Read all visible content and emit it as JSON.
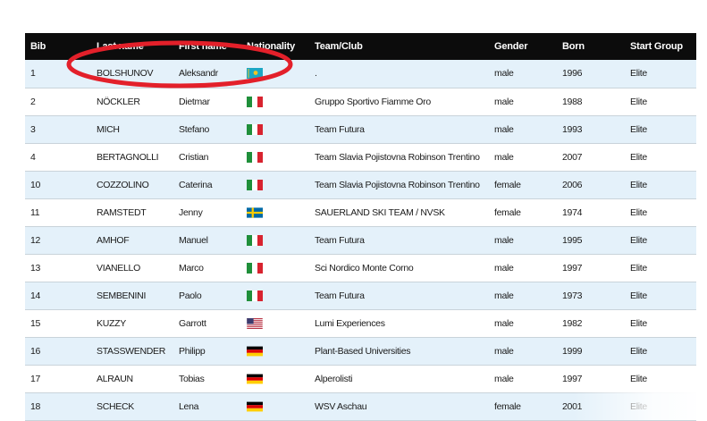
{
  "table": {
    "headers": [
      "Bib",
      "Last name",
      "First name",
      "Nationality",
      "Team/Club",
      "Gender",
      "Born",
      "Start Group"
    ],
    "rows": [
      {
        "bib": "1",
        "last": "BOLSHUNOV",
        "first": "Aleksandr",
        "flag": "kazakhstan-flag-icon",
        "team": ".",
        "gender": "male",
        "born": "1996",
        "group": "Elite"
      },
      {
        "bib": "2",
        "last": "NÖCKLER",
        "first": "Dietmar",
        "flag": "italy-flag-icon",
        "team": "Gruppo Sportivo Fiamme Oro",
        "gender": "male",
        "born": "1988",
        "group": "Elite"
      },
      {
        "bib": "3",
        "last": "MICH",
        "first": "Stefano",
        "flag": "italy-flag-icon",
        "team": "Team Futura",
        "gender": "male",
        "born": "1993",
        "group": "Elite"
      },
      {
        "bib": "4",
        "last": "BERTAGNOLLI",
        "first": "Cristian",
        "flag": "italy-flag-icon",
        "team": "Team Slavia Pojistovna Robinson Trentino",
        "gender": "male",
        "born": "2007",
        "group": "Elite"
      },
      {
        "bib": "10",
        "last": "COZZOLINO",
        "first": "Caterina",
        "flag": "italy-flag-icon",
        "team": "Team Slavia Pojistovna Robinson Trentino",
        "gender": "female",
        "born": "2006",
        "group": "Elite"
      },
      {
        "bib": "11",
        "last": "RAMSTEDT",
        "first": "Jenny",
        "flag": "sweden-flag-icon",
        "team": "SAUERLAND SKI TEAM / NVSK",
        "gender": "female",
        "born": "1974",
        "group": "Elite"
      },
      {
        "bib": "12",
        "last": "AMHOF",
        "first": "Manuel",
        "flag": "italy-flag-icon",
        "team": "Team Futura",
        "gender": "male",
        "born": "1995",
        "group": "Elite"
      },
      {
        "bib": "13",
        "last": "VIANELLO",
        "first": "Marco",
        "flag": "italy-flag-icon",
        "team": "Sci Nordico Monte Corno",
        "gender": "male",
        "born": "1997",
        "group": "Elite"
      },
      {
        "bib": "14",
        "last": "SEMBENINI",
        "first": "Paolo",
        "flag": "italy-flag-icon",
        "team": "Team Futura",
        "gender": "male",
        "born": "1973",
        "group": "Elite"
      },
      {
        "bib": "15",
        "last": "KUZZY",
        "first": "Garrott",
        "flag": "usa-flag-icon",
        "team": "Lumi Experiences",
        "gender": "male",
        "born": "1982",
        "group": "Elite"
      },
      {
        "bib": "16",
        "last": "STASSWENDER",
        "first": "Philipp",
        "flag": "germany-flag-icon",
        "team": "Plant-Based Universities",
        "gender": "male",
        "born": "1999",
        "group": "Elite"
      },
      {
        "bib": "17",
        "last": "ALRAUN",
        "first": "Tobias",
        "flag": "germany-flag-icon",
        "team": "Alperolisti",
        "gender": "male",
        "born": "1997",
        "group": "Elite"
      },
      {
        "bib": "18",
        "last": "SCHECK",
        "first": "Lena",
        "flag": "germany-flag-icon",
        "team": "WSV Aschau",
        "gender": "female",
        "born": "2001",
        "group": "Elite"
      }
    ]
  },
  "colors": {
    "header_bg": "#0c0c0c",
    "row_alt": "#e4f1fa",
    "annotation": "#e3202a"
  }
}
